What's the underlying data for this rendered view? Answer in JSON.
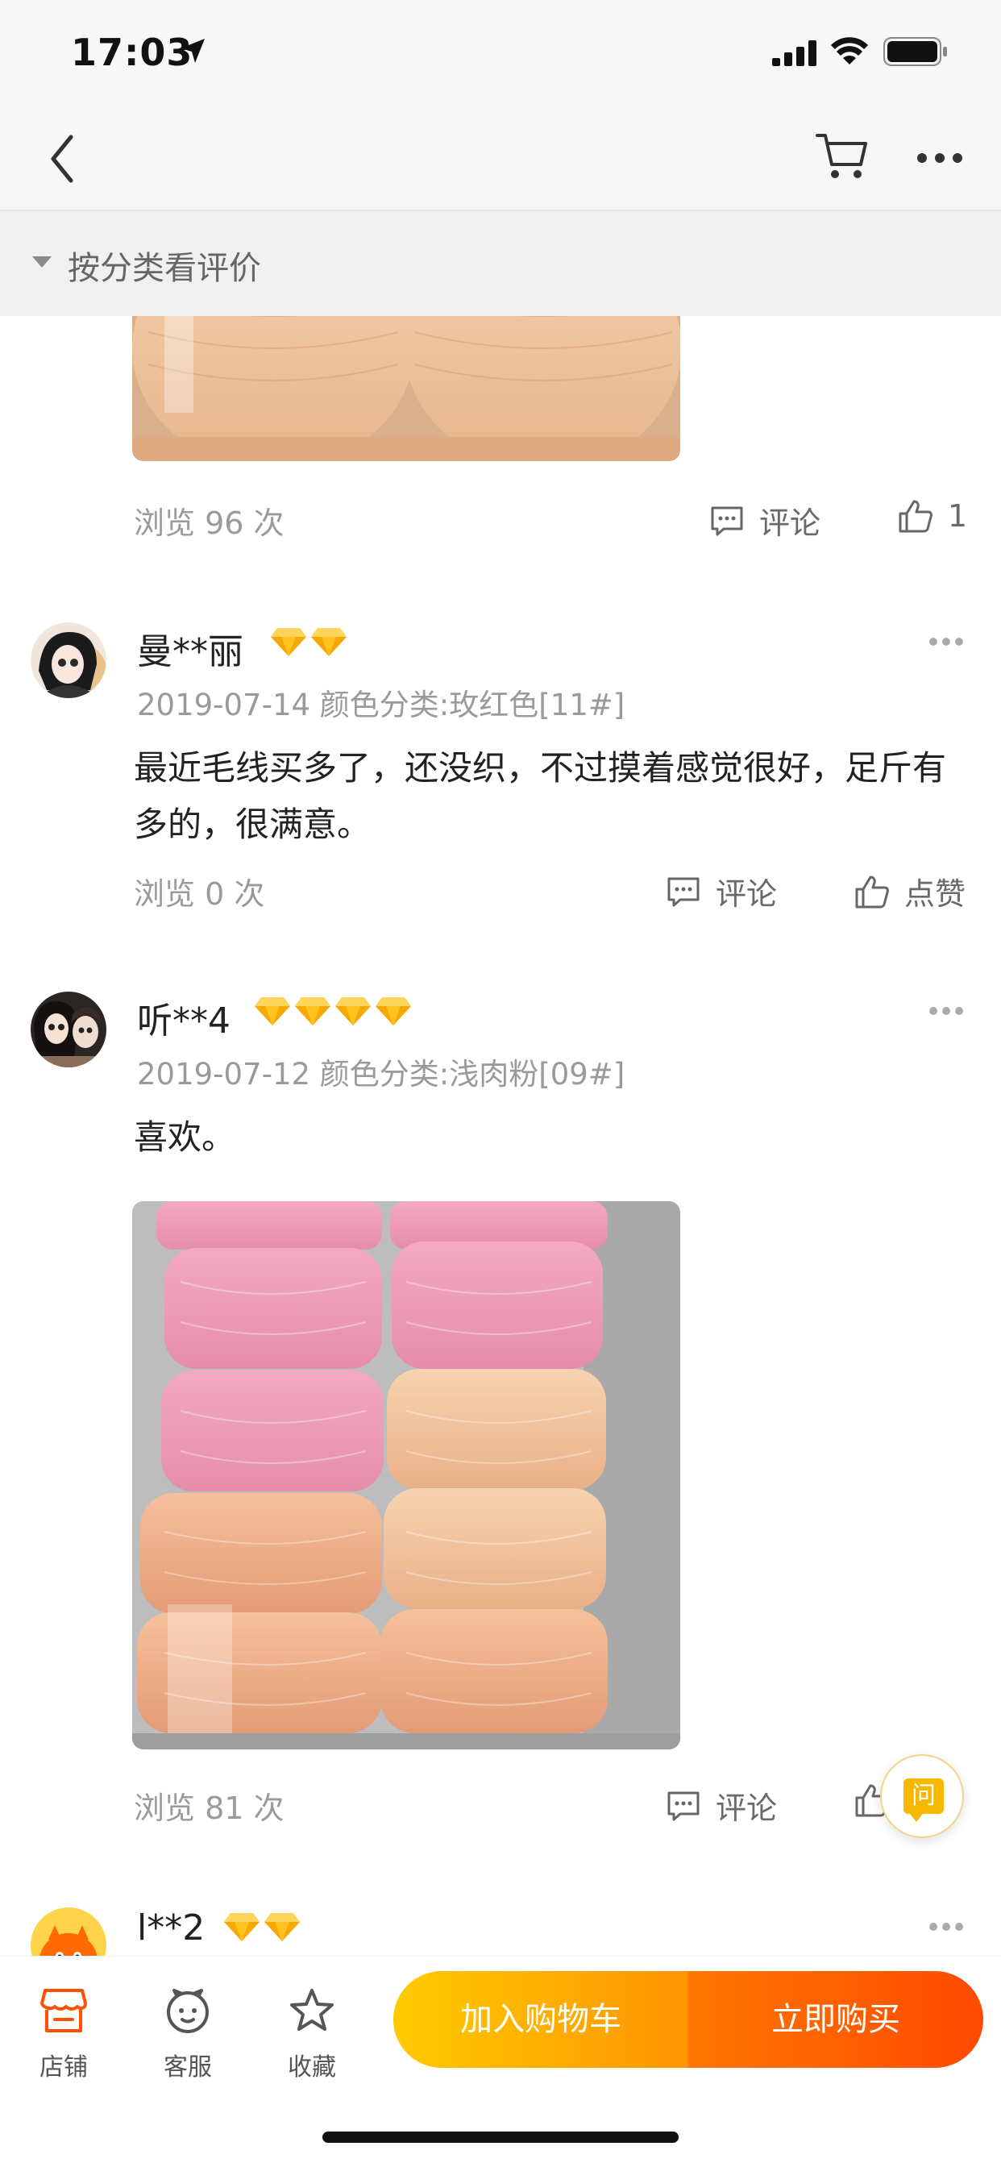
{
  "status_bar": {
    "time": "17:03"
  },
  "filter": {
    "label": "按分类看评价"
  },
  "reviews": [
    {
      "views": "浏览 96 次",
      "comment_label": "评论",
      "like_count": "1"
    },
    {
      "user": "曼**丽",
      "badge_count": 2,
      "date_and_sku": "2019-07-14 颜色分类:玫红色[11#]",
      "text": "最近毛线买多了，还没织，不过摸着感觉很好，足斤有多的，很满意。",
      "views": "浏览 0 次",
      "comment_label": "评论",
      "like_label": "点赞"
    },
    {
      "user": "听**4",
      "badge_count": 4,
      "date_and_sku": "2019-07-12 颜色分类:浅肉粉[09#]",
      "text": "喜欢。",
      "views": "浏览 81 次",
      "comment_label": "评论"
    },
    {
      "user": "l**2",
      "badge_count": 2
    }
  ],
  "float_button": {
    "label": "问"
  },
  "bottom_bar": {
    "tabs": [
      {
        "label": "店铺",
        "icon": "store-icon"
      },
      {
        "label": "客服",
        "icon": "customer-service-icon"
      },
      {
        "label": "收藏",
        "icon": "star-icon"
      }
    ],
    "add_to_cart": "加入购物车",
    "buy_now": "立即购买"
  },
  "colors": {
    "accent_orange": "#ff5000",
    "cart_gradient_start": "#ffcb00",
    "buy_gradient_end": "#ff4a00",
    "badge_gold": "#f7b800"
  }
}
